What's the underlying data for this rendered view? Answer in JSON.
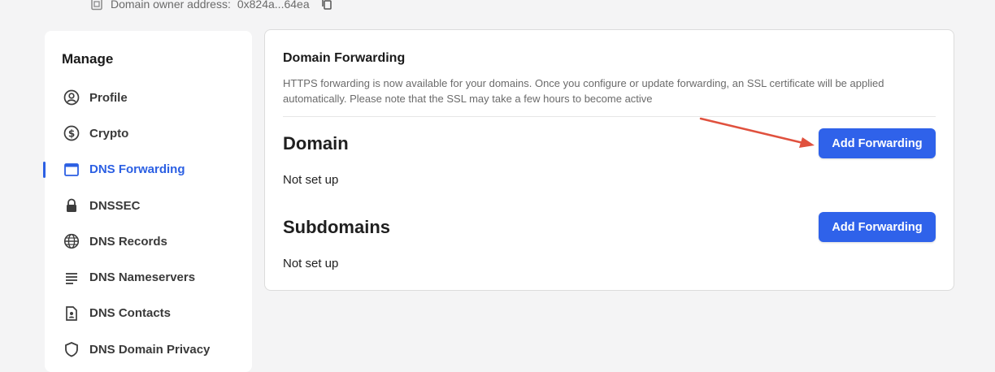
{
  "header": {
    "owner_label": "Domain owner address:",
    "owner_address": "0x824a...64ea"
  },
  "sidebar": {
    "title": "Manage",
    "items": [
      {
        "label": "Profile",
        "icon": "user-circle-icon",
        "active": false
      },
      {
        "label": "Crypto",
        "icon": "dollar-circle-icon",
        "active": false
      },
      {
        "label": "DNS Forwarding",
        "icon": "browser-window-icon",
        "active": true
      },
      {
        "label": "DNSSEC",
        "icon": "lock-icon",
        "active": false
      },
      {
        "label": "DNS Records",
        "icon": "globe-icon",
        "active": false
      },
      {
        "label": "DNS Nameservers",
        "icon": "list-lines-icon",
        "active": false
      },
      {
        "label": "DNS Contacts",
        "icon": "contact-card-icon",
        "active": false
      },
      {
        "label": "DNS Domain Privacy",
        "icon": "shield-icon",
        "active": false
      }
    ]
  },
  "card": {
    "title": "Domain Forwarding",
    "description": "HTTPS forwarding is now available for your domains. Once you configure or update forwarding, an SSL certificate will be applied automatically. Please note that the SSL may take a few hours to become active",
    "sections": {
      "domain": {
        "heading": "Domain",
        "status": "Not set up",
        "button": "Add Forwarding"
      },
      "subdomains": {
        "heading": "Subdomains",
        "status": "Not set up",
        "button": "Add Forwarding"
      }
    }
  },
  "colors": {
    "accent": "#2f62ea",
    "active_nav": "#2b5fe3",
    "annotation_arrow": "#e0513e",
    "page_bg": "#f4f4f5"
  }
}
